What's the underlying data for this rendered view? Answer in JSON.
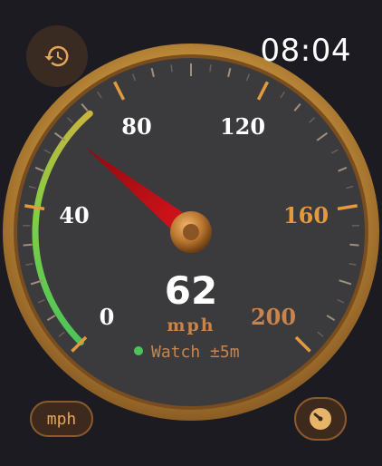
{
  "status_bar": {
    "time": "08:04"
  },
  "gauge": {
    "speed": "62",
    "speed_value": 62,
    "unit": "mph",
    "max": 200,
    "tick_labels": [
      "0",
      "40",
      "80",
      "120",
      "160",
      "200"
    ],
    "watch_text": "Watch ±5m",
    "watch_status_color": "#4cc45a"
  },
  "controls": {
    "history_icon": "history-icon",
    "unit_toggle_label": "mph",
    "mode_icon": "gauge-icon"
  },
  "colors": {
    "bezel": "#c9953e",
    "dial": "#3a3a3c",
    "needle": "#c8101a",
    "accent_orange": "#e39a3c",
    "green_arc": "#5ccf4e",
    "yellow_arc": "#c9b53c"
  }
}
